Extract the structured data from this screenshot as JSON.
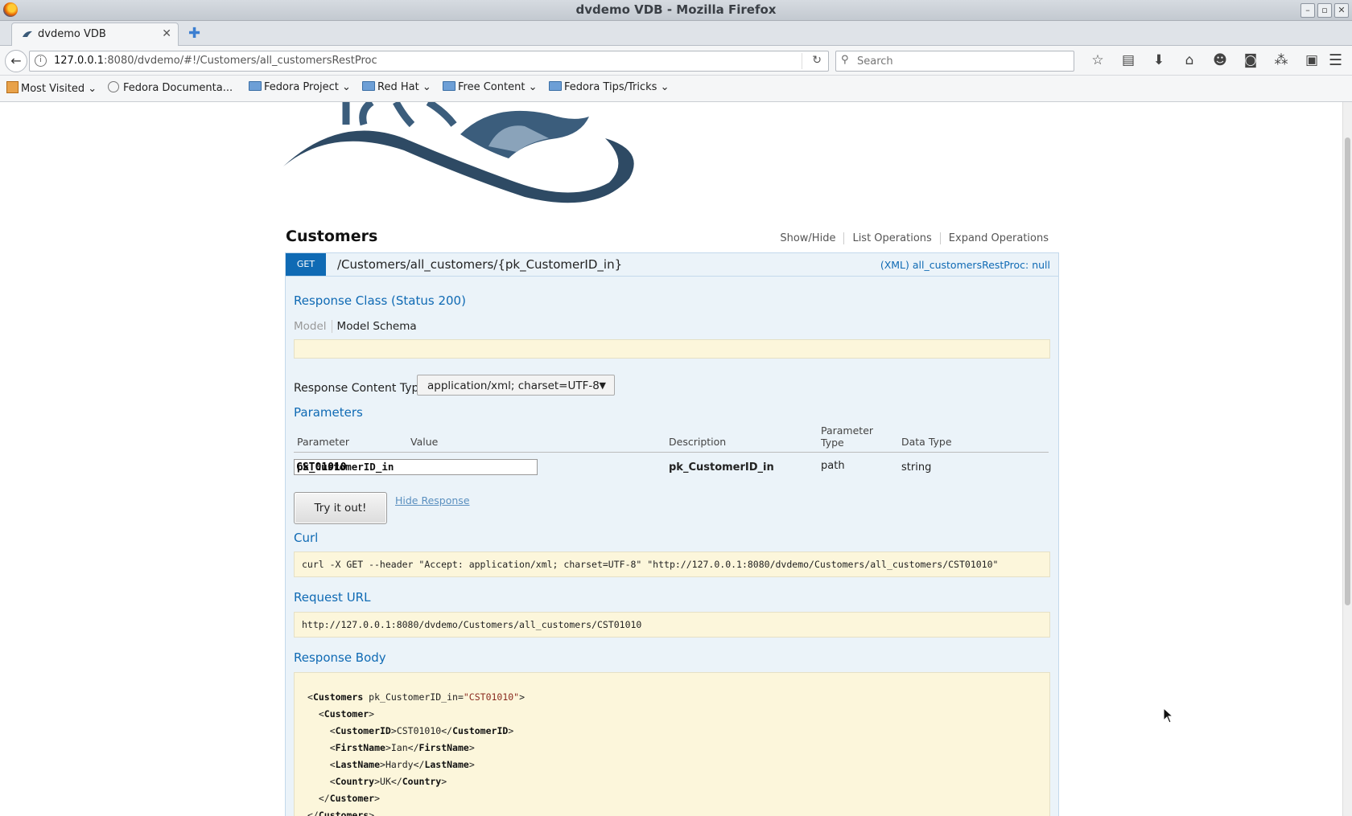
{
  "window": {
    "title": "dvdemo VDB - Mozilla Firefox",
    "buttons": [
      "–",
      "▫",
      "✕"
    ]
  },
  "tab": {
    "title": "dvdemo VDB",
    "close": "✕",
    "new_tab": "✚"
  },
  "nav": {
    "back": "←",
    "url_host": "127.0.0.1",
    "url_rest": ":8080/dvdemo/#!/Customers/all_customersRestProc",
    "reload": "↻",
    "search_placeholder": "Search",
    "search_icon": "⚲",
    "toolbar_icons": [
      "☆",
      "▤",
      "⬇",
      "⌂",
      "☻",
      "◙",
      "⁂",
      "▣"
    ],
    "menu": "☰"
  },
  "bookmarks": [
    {
      "label": "Most Visited",
      "icon": "most-visited-icon"
    },
    {
      "label": "Fedora Documenta...",
      "icon": "globe-icon"
    },
    {
      "label": "Fedora Project",
      "icon": "folder-icon"
    },
    {
      "label": "Red Hat",
      "icon": "folder-icon"
    },
    {
      "label": "Free Content",
      "icon": "folder-icon"
    },
    {
      "label": "Fedora Tips/Tricks",
      "icon": "folder-icon"
    }
  ],
  "api": {
    "section_title": "Customers",
    "links": [
      "Show/Hide",
      "List Operations",
      "Expand Operations"
    ],
    "method": "GET",
    "path": "/Customers/all_customers/{pk_CustomerID_in}",
    "summary": "(XML) all_customersRestProc: null",
    "response_class_title": "Response Class (Status 200)",
    "model_tab": "Model",
    "model_schema_tab": "Model Schema",
    "content_type_label": "Response Content Type",
    "content_type_value": "application/xml; charset=UTF-8",
    "parameters_title": "Parameters",
    "param_headers": [
      "Parameter",
      "Value",
      "Description",
      "Parameter Type",
      "Data Type"
    ],
    "param": {
      "name": "pk_CustomerID_in",
      "value": "CST01010",
      "description": "pk_CustomerID_in",
      "type": "path",
      "data_type": "string"
    },
    "try_button": "Try it out!",
    "hide_response": "Hide Response",
    "curl_title": "Curl",
    "curl": "curl -X GET --header \"Accept: application/xml; charset=UTF-8\" \"http://127.0.0.1:8080/dvdemo/Customers/all_customers/CST01010\"",
    "request_url_title": "Request URL",
    "request_url": "http://127.0.0.1:8080/dvdemo/Customers/all_customers/CST01010",
    "response_body_title": "Response Body",
    "xml": {
      "l1_tag": "Customers",
      "l1_attr": " pk_CustomerID_in=",
      "l1_val": "\"CST01010\"",
      "l2_tag": "Customer",
      "customer_id_tag": "CustomerID",
      "customer_id": "CST01010",
      "first_name_tag": "FirstName",
      "first_name": "Ian",
      "last_name_tag": "LastName",
      "last_name": "Hardy",
      "country_tag": "Country",
      "country": "UK"
    }
  }
}
